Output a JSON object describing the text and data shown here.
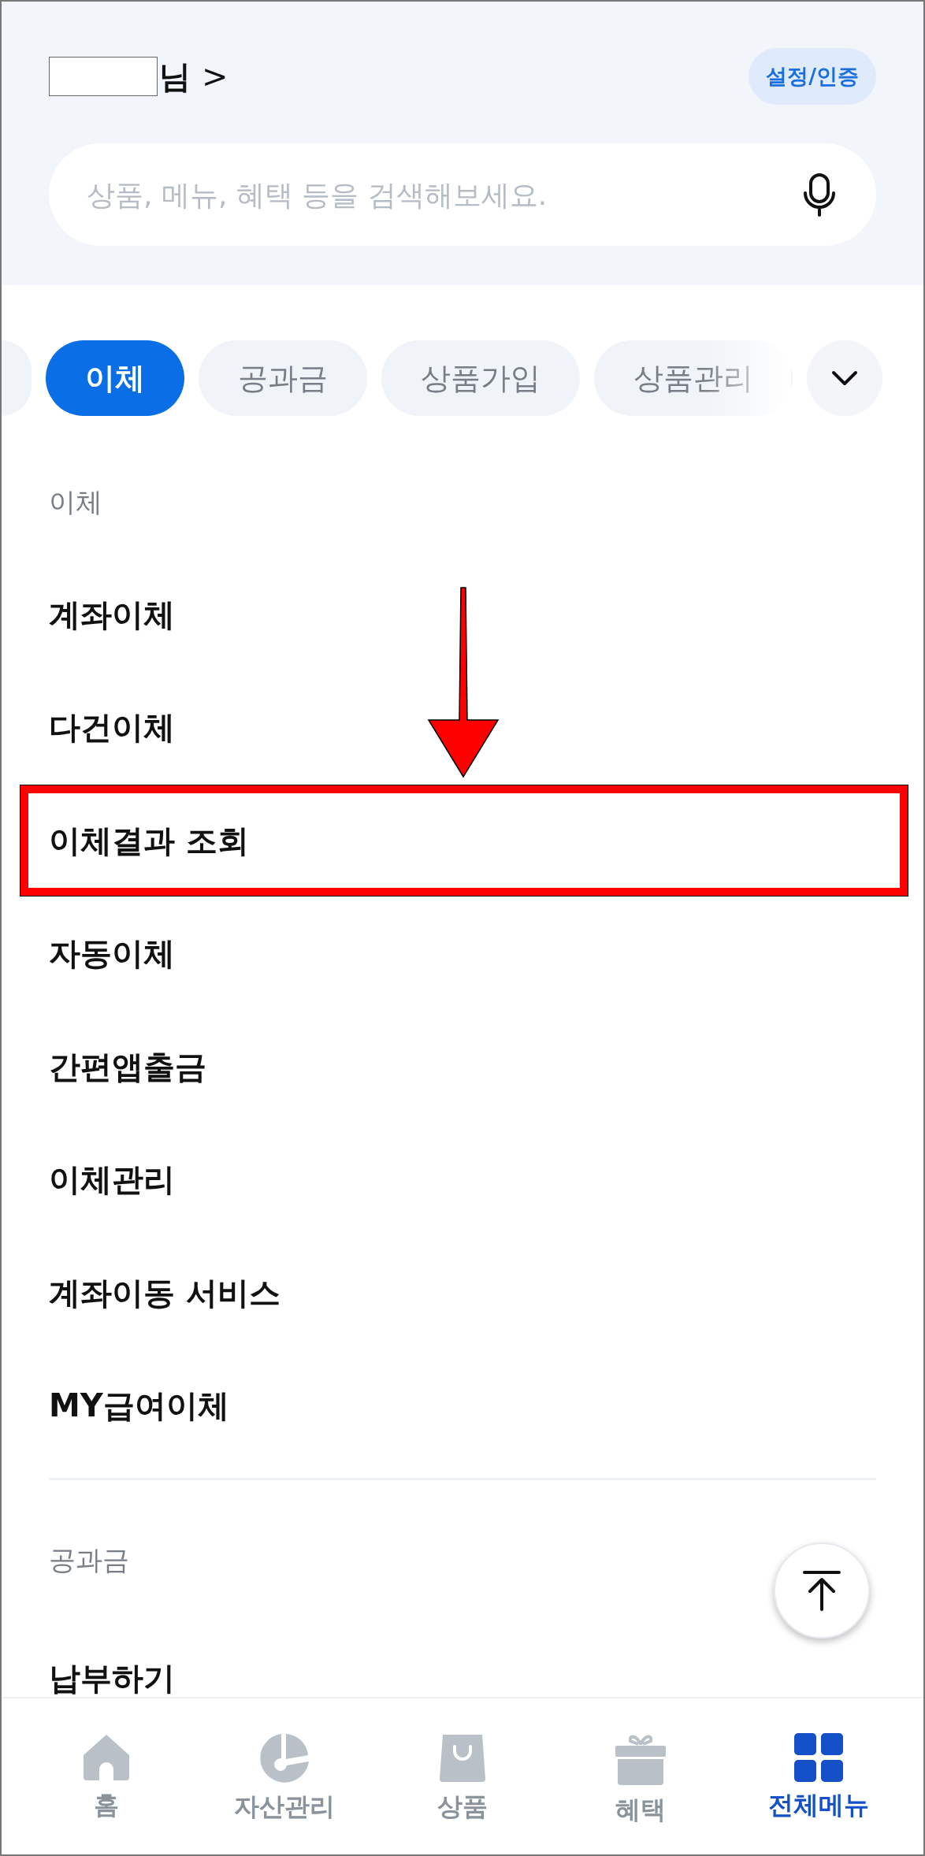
{
  "header": {
    "greeting_suffix": "님",
    "chevron": ">",
    "settings_button": "설정/인증"
  },
  "search": {
    "placeholder": "상품, 메뉴, 혜택 등을 검색해보세요."
  },
  "tabs": [
    {
      "kind": "clipped",
      "selected": false
    },
    {
      "label": "이체",
      "selected": true
    },
    {
      "label": "공과금",
      "selected": false
    },
    {
      "label": "상품가입",
      "selected": false
    },
    {
      "label": "상품관리",
      "selected": false
    }
  ],
  "sections": [
    {
      "title": "이체",
      "items": [
        {
          "label": "계좌이체",
          "highlighted": false
        },
        {
          "label": "다건이체",
          "highlighted": false
        },
        {
          "label": "이체결과 조회",
          "highlighted": true
        },
        {
          "label": "자동이체",
          "highlighted": false
        },
        {
          "label": "간편앱출금",
          "highlighted": false
        },
        {
          "label": "이체관리",
          "highlighted": false
        },
        {
          "label": "계좌이동 서비스",
          "highlighted": false
        },
        {
          "label": "MY급여이체",
          "highlighted": false
        }
      ]
    },
    {
      "title": "공과금",
      "items": [
        {
          "label": "납부하기",
          "highlighted": false
        }
      ]
    }
  ],
  "bottom_nav": [
    {
      "label": "홈",
      "selected": false
    },
    {
      "label": "자산관리",
      "selected": false
    },
    {
      "label": "상품",
      "selected": false
    },
    {
      "label": "혜택",
      "selected": false
    },
    {
      "label": "전체메뉴",
      "selected": true
    }
  ]
}
